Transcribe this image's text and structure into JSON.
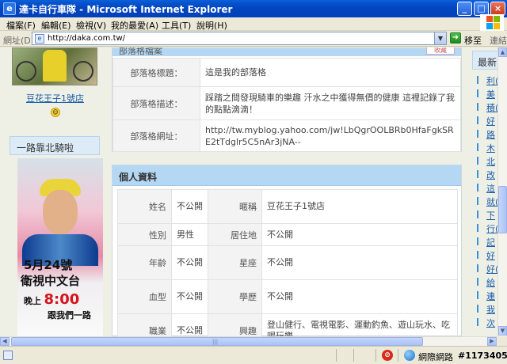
{
  "window": {
    "title": "達卡自行車隊 - Microsoft Internet Explorer",
    "minimize": "_",
    "maximize": "□",
    "close": "×"
  },
  "menu": {
    "items": [
      "檔案(F)",
      "編輯(E)",
      "檢視(V)",
      "我的最愛(A)",
      "工具(T)",
      "說明(H)"
    ]
  },
  "address": {
    "label": "網址(D)",
    "url": "http://daka.com.tw/",
    "go_label": "移至",
    "links_label": "連結"
  },
  "sidebar": {
    "blog_link": "豆花王子1號店",
    "section_title": "一路靠北騎啦",
    "promo": {
      "date": "5月24號",
      "channel": "衛視中文台",
      "time_prefix": "晚上",
      "time": "8:00",
      "tagline": "跟我們一路"
    }
  },
  "blog_info": {
    "title": "部落格檔案",
    "tab_label": "收藏",
    "rows": [
      {
        "key": "部落格標題：",
        "value": "這是我的部落格"
      },
      {
        "key": "部落格描述：",
        "value": "踩踏之間發現騎車的樂趣 汗水之中獲得無價的健康 這裡記錄了我的點點滴滴！"
      },
      {
        "key": "部落格網址：",
        "value": "http://tw.myblog.yahoo.com/jw!LbQgrOOLBRb0HfaFgkSRE2tTdglr5C5nAr3jNA--"
      }
    ]
  },
  "profile": {
    "title": "個人資料",
    "rows": [
      {
        "k1": "姓名",
        "v1": "不公開",
        "k2": "暱稱",
        "v2": "豆花王子1號店"
      },
      {
        "k1": "性別",
        "v1": "男性",
        "k2": "居住地",
        "v2": "不公開"
      },
      {
        "k1": "年齡",
        "v1": "不公開",
        "k2": "星座",
        "v2": "不公開"
      },
      {
        "k1": "血型",
        "v1": "不公開",
        "k2": "學歷",
        "v2": "不公開"
      },
      {
        "k1": "職業",
        "v1": "不公開",
        "k2": "興趣",
        "v2": "登山健行、電視電影、運動釣魚、遊山玩水、吃喝玩樂"
      }
    ]
  },
  "right_sidebar": {
    "title": "最新",
    "items": [
      "利(",
      "美",
      "積(",
      "好",
      "路",
      "木",
      "北",
      "改",
      "這",
      "就(",
      "下",
      "行(",
      "記",
      "好",
      "好(",
      "給",
      "連",
      "我",
      "次"
    ]
  },
  "status": {
    "zone": "網際網路",
    "watermark": "#1173405"
  }
}
